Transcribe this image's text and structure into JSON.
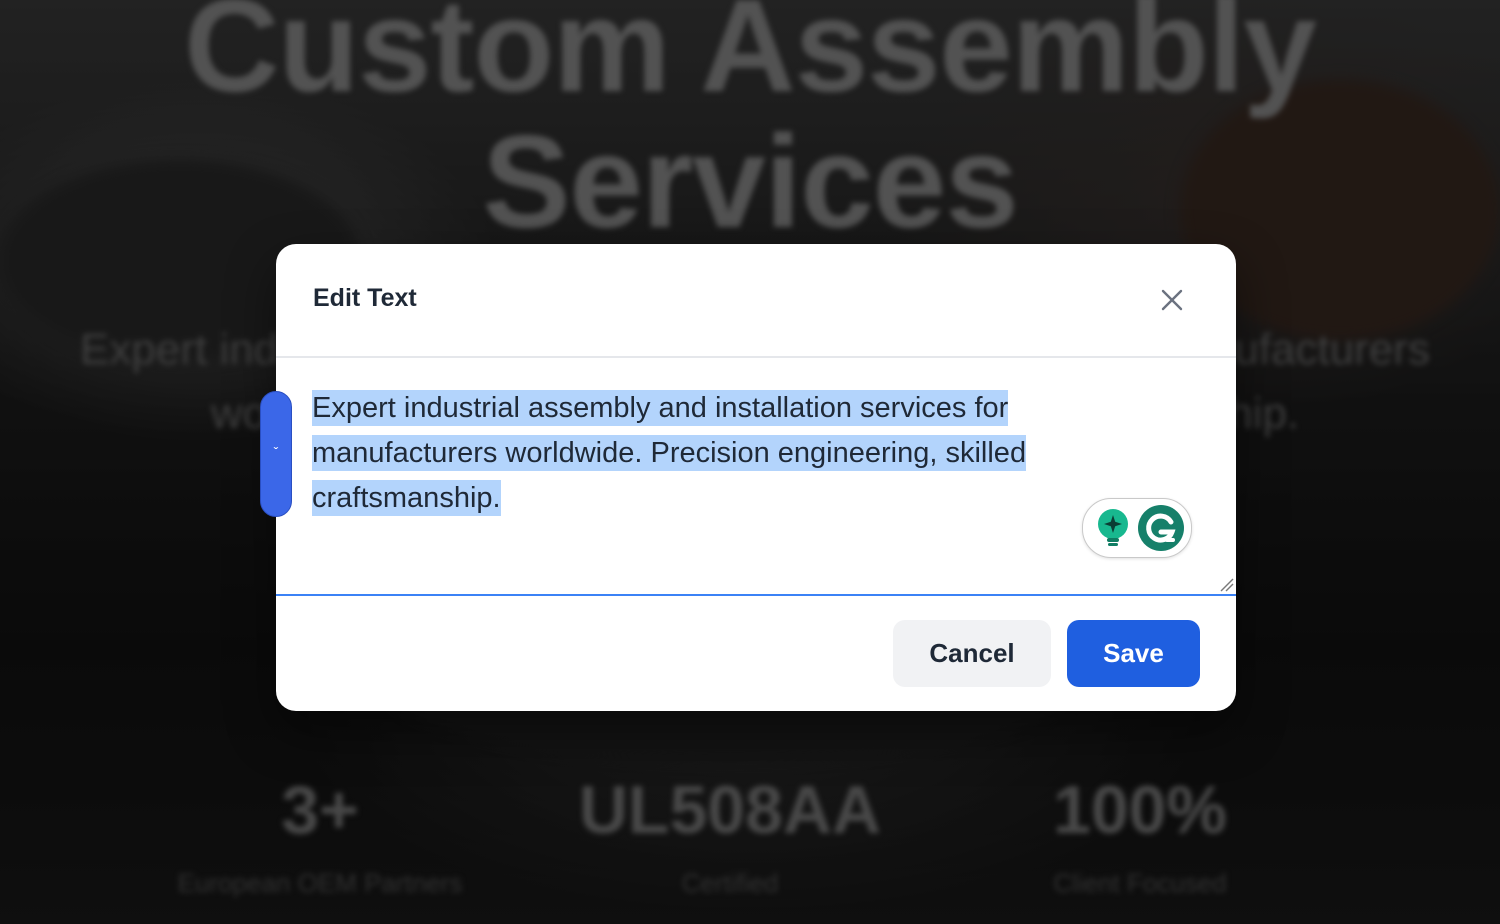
{
  "background": {
    "hero_title_line1": "Custom Assembly",
    "hero_title_line2": "Services",
    "hero_subtitle_line1": "Expert industrial assembly and installation services for manufacturers",
    "hero_subtitle_line2": "worldwide. Precision engineering, skilled craftsmanship.",
    "stats": [
      {
        "value": "3+",
        "label": "European OEM Partners"
      },
      {
        "value": "UL508AA",
        "label": "Certified"
      },
      {
        "value": "100%",
        "label": "Client Focused"
      }
    ]
  },
  "modal": {
    "title": "Edit Text",
    "close_icon": "close-icon",
    "editor_value": "Expert industrial assembly and installation services for manufacturers worldwide. Precision engineering, skilled craftsmanship.",
    "cancel_label": "Cancel",
    "save_label": "Save"
  },
  "side_handle": {
    "icon": "chevron-down-icon",
    "glyph": "ˇ"
  },
  "grammarly": {
    "icons": [
      "lightbulb-sparkle-icon",
      "grammarly-g-icon"
    ]
  },
  "colors": {
    "primary": "#1f5fe0",
    "selection": "#b3d4fc",
    "handle": "#3b67e8"
  }
}
